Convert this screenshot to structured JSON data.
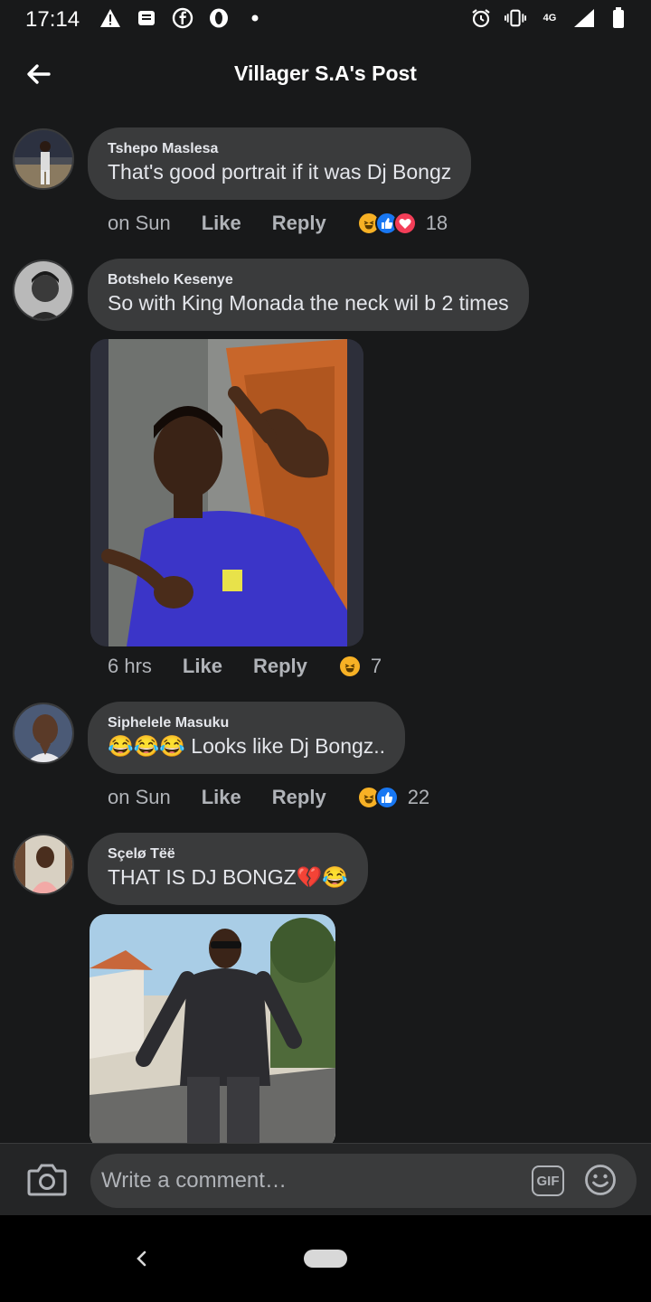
{
  "status_bar": {
    "time": "17:14",
    "network": "4G"
  },
  "header": {
    "title": "Villager S.A's Post"
  },
  "comments": [
    {
      "author": "Tshepo Maslesa",
      "text": "That's good portrait if it was Dj Bongz",
      "when": "on Sun",
      "like_label": "Like",
      "reply_label": "Reply",
      "reactions": [
        "haha",
        "like",
        "love"
      ],
      "reaction_count": "18"
    },
    {
      "author": "Botshelo Kesenye",
      "text": "So with King Monada the neck wil b 2 times",
      "when": "6 hrs",
      "like_label": "Like",
      "reply_label": "Reply",
      "reactions": [
        "haha"
      ],
      "reaction_count": "7"
    },
    {
      "author": "Siphelele Masuku",
      "text": "😂😂😂 Looks like Dj Bongz..",
      "when": "on Sun",
      "like_label": "Like",
      "reply_label": "Reply",
      "reactions": [
        "haha",
        "like"
      ],
      "reaction_count": "22"
    },
    {
      "author": "Sçelø Tëë",
      "text": "THAT IS DJ BONGZ💔😂"
    }
  ],
  "composer": {
    "placeholder": "Write a comment…",
    "gif_label": "GIF"
  },
  "colors": {
    "background": "#18191a",
    "bubble": "#3a3b3c",
    "secondary_text": "#b0b3b8",
    "like_blue": "#1877f2",
    "love_red": "#f33e58",
    "haha_yellow": "#f7b125"
  }
}
